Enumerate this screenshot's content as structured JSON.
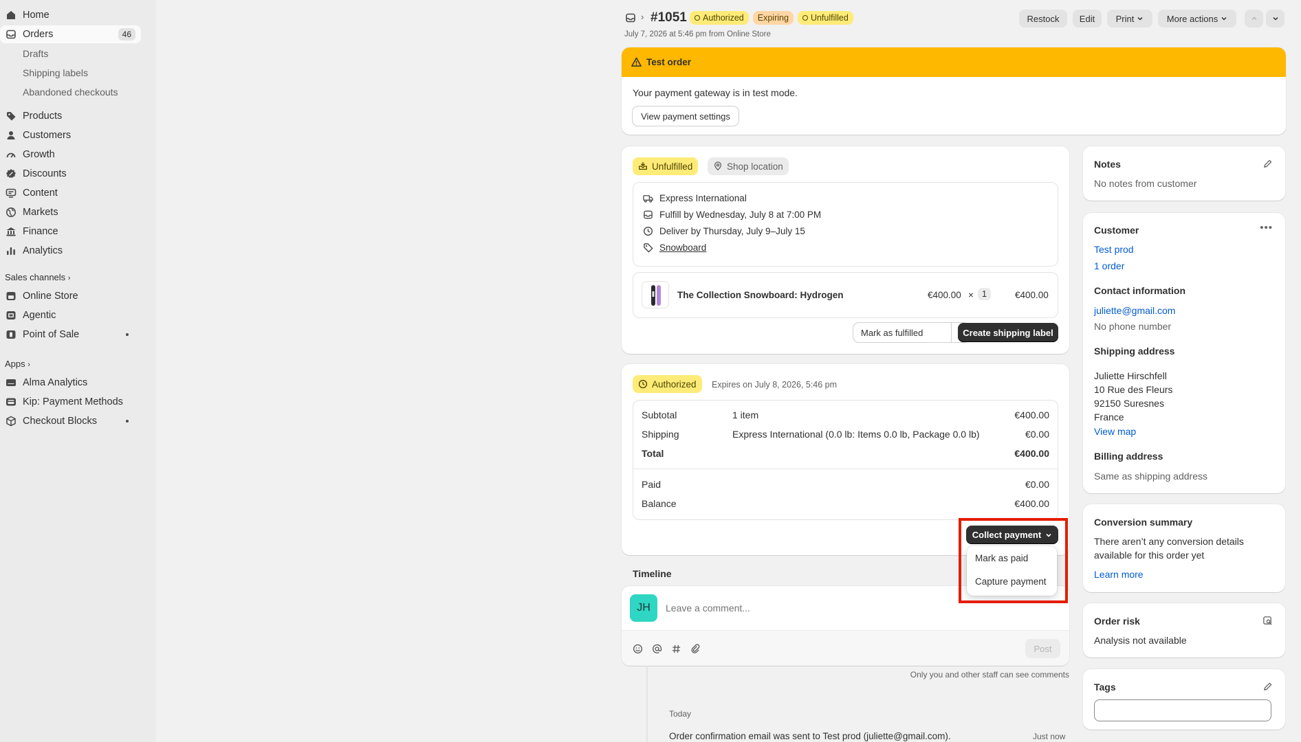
{
  "sidebar": {
    "home": "Home",
    "orders": "Orders",
    "orders_count": "46",
    "orders_sub": [
      "Drafts",
      "Shipping labels",
      "Abandoned checkouts"
    ],
    "main_items": [
      "Products",
      "Customers",
      "Growth",
      "Discounts",
      "Content",
      "Markets",
      "Finance",
      "Analytics"
    ],
    "sales_channels_label": "Sales channels",
    "sales_channels": [
      "Online Store",
      "Agentic",
      "Point of Sale"
    ],
    "apps_label": "Apps",
    "apps": [
      "Alma Analytics",
      "Kip: Payment Methods",
      "Checkout Blocks"
    ]
  },
  "header": {
    "order_number": "#1051",
    "badges": [
      "Authorized",
      "Expiring",
      "Unfulfilled"
    ],
    "subtitle": "July 7, 2026 at 5:46 pm from Online Store",
    "buttons": {
      "restock": "Restock",
      "edit": "Edit",
      "print": "Print",
      "more": "More actions"
    }
  },
  "test_banner": {
    "title": "Test order",
    "text": "Your payment gateway is in test mode.",
    "button": "View payment settings"
  },
  "fulfillment": {
    "status": "Unfulfilled",
    "location": "Shop location",
    "details": [
      "Express International",
      "Fulfill by Wednesday, July 8 at 7:00 PM",
      "Deliver by Thursday, July 9–July 15",
      "Snowboard"
    ],
    "item_name": "The Collection Snowboard: Hydrogen",
    "item_price": "€400.00",
    "times": "×",
    "item_qty": "1",
    "item_total": "€400.00",
    "mark_fulfilled": "Mark as fulfilled",
    "create_label": "Create shipping label"
  },
  "payment": {
    "status": "Authorized",
    "expires": "Expires on July 8, 2026, 5:46 pm",
    "subtotal_label": "Subtotal",
    "subtotal_desc": "1 item",
    "subtotal_value": "€400.00",
    "shipping_label": "Shipping",
    "shipping_desc": "Express International (0.0 lb: Items 0.0 lb, Package 0.0 lb)",
    "shipping_value": "€0.00",
    "total_label": "Total",
    "total_value": "€400.00",
    "paid_label": "Paid",
    "paid_value": "€0.00",
    "balance_label": "Balance",
    "balance_value": "€400.00",
    "collect_button": "Collect payment",
    "dropdown": [
      "Mark as paid",
      "Capture payment"
    ]
  },
  "timeline": {
    "title": "Timeline",
    "avatar": "JH",
    "placeholder": "Leave a comment...",
    "post": "Post",
    "staff_note": "Only you and other staff can see comments",
    "day": "Today",
    "event": "Order confirmation email was sent to Test prod (juliette@gmail.com).",
    "event_time": "Just now"
  },
  "notes": {
    "title": "Notes",
    "text": "No notes from customer"
  },
  "customer": {
    "title": "Customer",
    "name": "Test prod",
    "orders": "1 order",
    "contact_title": "Contact information",
    "email": "juliette@gmail.com",
    "phone": "No phone number",
    "shipping_title": "Shipping address",
    "address": [
      "Juliette Hirschfell",
      "10 Rue des Fleurs",
      "92150 Suresnes",
      "France"
    ],
    "view_map": "View map",
    "billing_title": "Billing address",
    "billing_text": "Same as shipping address"
  },
  "conversion": {
    "title": "Conversion summary",
    "text1": "There aren’t any conversion details",
    "text2": "available for this order yet",
    "link": "Learn more"
  },
  "risk": {
    "title": "Order risk",
    "text": "Analysis not available"
  },
  "tags": {
    "title": "Tags"
  },
  "colors": {
    "sidebar_bg": "#ebebeb",
    "banner_yellow": "#ffb800",
    "badge_yellow": "#ffeb78",
    "badge_orange": "#ffd6a4",
    "link": "#005bd3",
    "avatar": "#2fd6c3",
    "highlight": "#e51c00"
  }
}
